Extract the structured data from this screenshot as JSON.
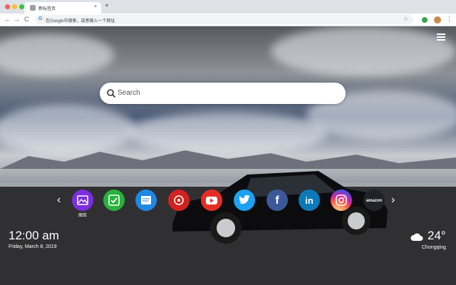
{
  "browser": {
    "tab_title": "新标签页",
    "close_glyph": "×",
    "newtab_glyph": "+",
    "back_glyph": "←",
    "forward_glyph": "→",
    "reload_glyph": "C",
    "address_placeholder": "在Google中搜索，或者输入一个网址",
    "google_glyph": "G",
    "star_glyph": "☆",
    "menu_glyph": "⋮"
  },
  "search": {
    "placeholder": "Search"
  },
  "nav": {
    "prev_glyph": "‹",
    "next_glyph": "›"
  },
  "apps": [
    {
      "id": "gallery",
      "label": "图库",
      "color": "#7b2fe0",
      "icon": "image-icon"
    },
    {
      "id": "tasks",
      "label": "",
      "color": "#27b33b",
      "icon": "check-icon"
    },
    {
      "id": "notes",
      "label": "",
      "color": "#1e88e5",
      "icon": "note-icon"
    },
    {
      "id": "game",
      "label": "",
      "color": "#d32121",
      "icon": "game-icon"
    },
    {
      "id": "youtube",
      "label": "",
      "color": "#e52d27",
      "icon": "youtube-icon"
    },
    {
      "id": "twitter",
      "label": "",
      "color": "#1da1f2",
      "icon": "twitter-icon"
    },
    {
      "id": "facebook",
      "label": "",
      "color": "#3b5998",
      "icon": "facebook-icon",
      "glyph": "f"
    },
    {
      "id": "linkedin",
      "label": "",
      "color": "#0a7ab8",
      "icon": "linkedin-icon",
      "glyph": "in"
    },
    {
      "id": "instagram",
      "label": "",
      "color": "#c13584",
      "icon": "instagram-icon"
    },
    {
      "id": "amazon",
      "label": "",
      "color": "#1f2328",
      "icon": "amazon-icon",
      "glyph": "amazon"
    }
  ],
  "clock": {
    "time": "12:00 am",
    "date": "Friday, March 8, 2019"
  },
  "weather": {
    "temperature": "24°",
    "city": "Chongqing",
    "icon": "cloud-icon"
  },
  "colors": {
    "tabbar": "#dee1e6",
    "toolbar": "#ffffff"
  }
}
